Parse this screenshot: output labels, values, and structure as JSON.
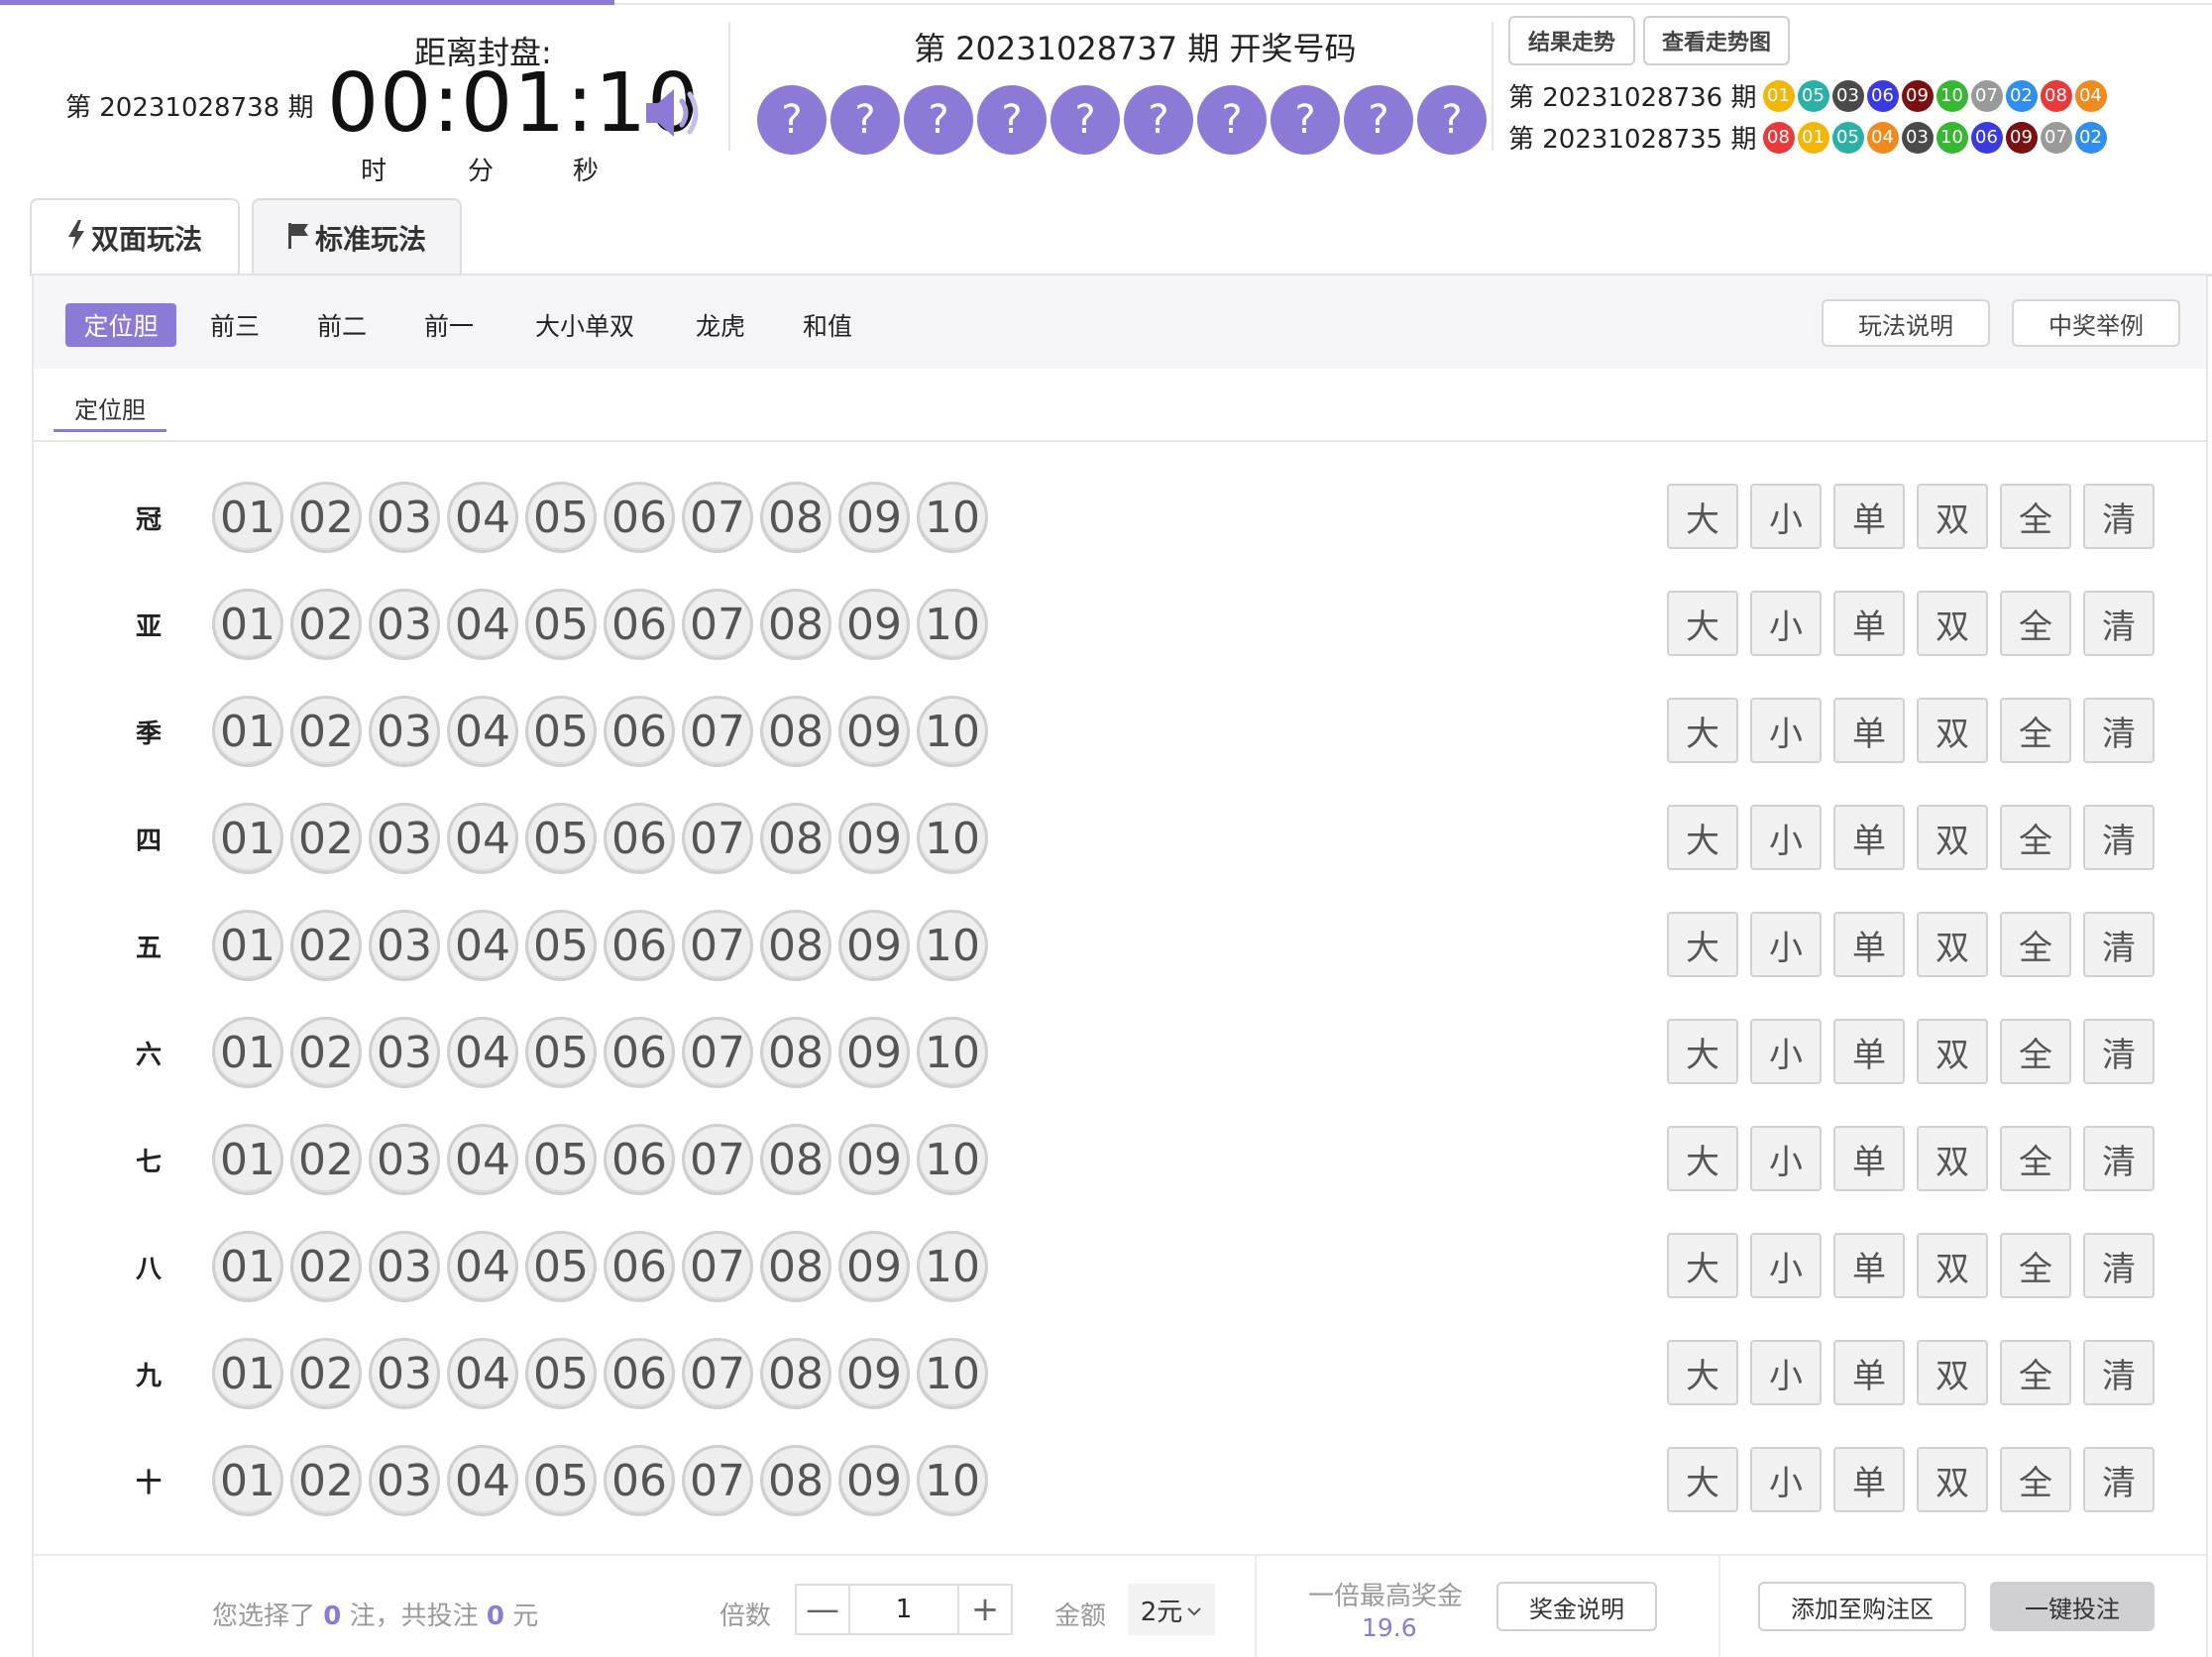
{
  "header": {
    "countdown_title": "距离封盘:",
    "current_issue": "第 20231028738 期",
    "timer": "00:01:10",
    "unit_hour": "时",
    "unit_minute": "分",
    "unit_second": "秒",
    "draw_title": "第 20231028737 期  开奖号码",
    "draw_placeholders": [
      "?",
      "?",
      "?",
      "?",
      "?",
      "?",
      "?",
      "?",
      "?",
      "?"
    ],
    "trend_button": "结果走势",
    "chart_button": "查看走势图",
    "history": [
      {
        "issue": "第 20231028736 期",
        "balls": [
          {
            "n": "01",
            "color": "#f2b705"
          },
          {
            "n": "05",
            "color": "#2ab0a6"
          },
          {
            "n": "03",
            "color": "#4a4a4a"
          },
          {
            "n": "06",
            "color": "#3a3ae0"
          },
          {
            "n": "09",
            "color": "#7a1010"
          },
          {
            "n": "10",
            "color": "#35b832"
          },
          {
            "n": "07",
            "color": "#9a9a9a"
          },
          {
            "n": "02",
            "color": "#2f8ff0"
          },
          {
            "n": "08",
            "color": "#e83a3a"
          },
          {
            "n": "04",
            "color": "#f08a1e"
          }
        ]
      },
      {
        "issue": "第 20231028735 期",
        "balls": [
          {
            "n": "08",
            "color": "#e83a3a"
          },
          {
            "n": "01",
            "color": "#f2b705"
          },
          {
            "n": "05",
            "color": "#2ab0a6"
          },
          {
            "n": "04",
            "color": "#f08a1e"
          },
          {
            "n": "03",
            "color": "#4a4a4a"
          },
          {
            "n": "10",
            "color": "#35b832"
          },
          {
            "n": "06",
            "color": "#3a3ae0"
          },
          {
            "n": "09",
            "color": "#7a1010"
          },
          {
            "n": "07",
            "color": "#9a9a9a"
          },
          {
            "n": "02",
            "color": "#2f8ff0"
          }
        ]
      }
    ]
  },
  "tabs": {
    "shuangmian": "双面玩法",
    "biaozhun": "标准玩法"
  },
  "subnav": {
    "items": [
      "定位胆",
      "前三",
      "前二",
      "前一",
      "大小单双",
      "龙虎",
      "和值"
    ],
    "active": "定位胆",
    "rules_button": "玩法说明",
    "example_button": "中奖举例"
  },
  "subtab": "定位胆",
  "rows": [
    "冠",
    "亚",
    "季",
    "四",
    "五",
    "六",
    "七",
    "八",
    "九",
    "十"
  ],
  "numbers": [
    "01",
    "02",
    "03",
    "04",
    "05",
    "06",
    "07",
    "08",
    "09",
    "10"
  ],
  "quick_buttons": [
    "大",
    "小",
    "单",
    "双",
    "全",
    "清"
  ],
  "footer": {
    "sel_prefix": "您选择了",
    "sel_count": "0",
    "sel_mid": "注，共投注",
    "sel_amount": "0",
    "sel_suffix": "元",
    "multiplier_label": "倍数",
    "multiplier_value": "1",
    "minus": "—",
    "plus": "+",
    "amount_label": "金额",
    "amount_value": "2元",
    "max_prize_label": "一倍最高奖金",
    "max_prize_value": "19.6",
    "prize_button": "奖金说明",
    "cart_button": "添加至购注区",
    "bet_button": "一键投注"
  },
  "colors": {
    "accent": "#8d7ad6"
  },
  "icons": {
    "sound": "speaker-icon",
    "lightning": "lightning-icon",
    "flag": "flag-icon",
    "chevron": "chevron-down-icon"
  }
}
